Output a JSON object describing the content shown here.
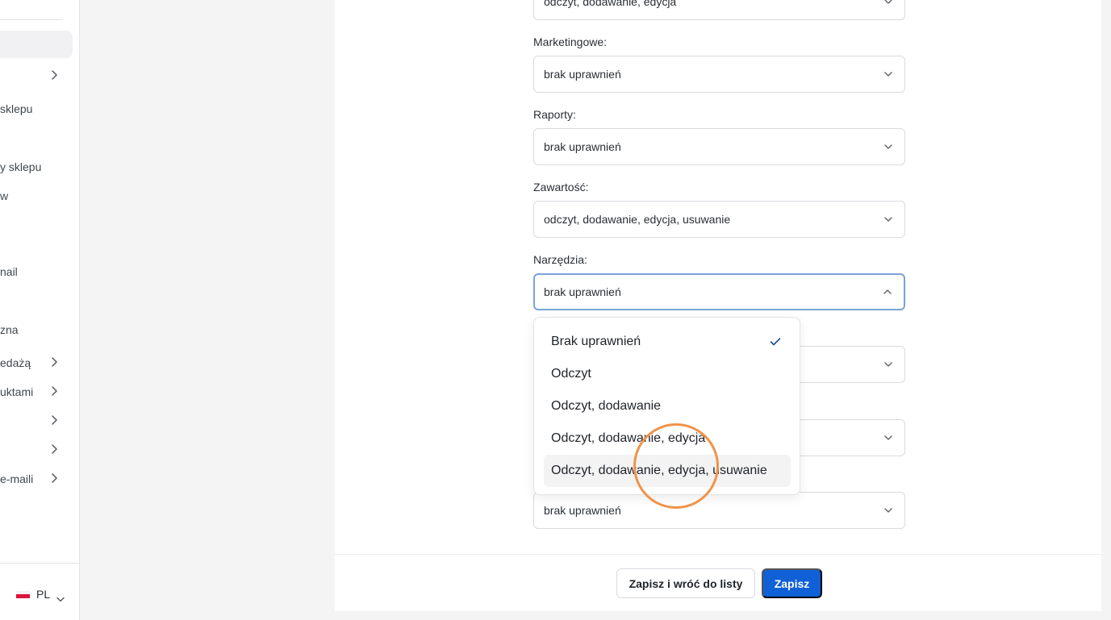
{
  "sidebar": {
    "items": [
      {
        "label": "sklepu",
        "has_chevron": false
      },
      {
        "label": "y sklepu",
        "has_chevron": false
      },
      {
        "label": "w",
        "has_chevron": false
      },
      {
        "label": "nail",
        "has_chevron": false
      },
      {
        "label": "zna",
        "has_chevron": false
      },
      {
        "label": "edażą",
        "has_chevron": true
      },
      {
        "label": "uktami",
        "has_chevron": true
      },
      {
        "label": "e-maili",
        "has_chevron": true
      }
    ],
    "language": {
      "code": "PL"
    }
  },
  "form": {
    "top_select_value": "odczyt, dodawanie, edycja",
    "fields": [
      {
        "label": "Marketingowe:",
        "value": "brak uprawnień"
      },
      {
        "label": "Raporty:",
        "value": "brak uprawnień"
      },
      {
        "label": "Zawartość:",
        "value": "odczyt, dodawanie, edycja, usuwanie"
      },
      {
        "label": "Narzędzia:",
        "value": "brak uprawnień"
      }
    ],
    "bottom_select_value": "brak uprawnień"
  },
  "dropdown": {
    "options": [
      {
        "label": "Brak uprawnień",
        "selected": true
      },
      {
        "label": "Odczyt",
        "selected": false
      },
      {
        "label": "Odczyt, dodawanie",
        "selected": false
      },
      {
        "label": "Odczyt, dodawanie, edycja",
        "selected": false
      },
      {
        "label": "Odczyt, dodawanie, edycja, usuwanie",
        "selected": false,
        "hovered": true
      }
    ]
  },
  "footer": {
    "save_and_back_label": "Zapisz i wróć do listy",
    "save_label": "Zapisz"
  },
  "colors": {
    "primary": "#1060d8",
    "focus_border": "#7aa2d8",
    "click_indicator": "#f0934a",
    "check": "#1d4f91"
  }
}
